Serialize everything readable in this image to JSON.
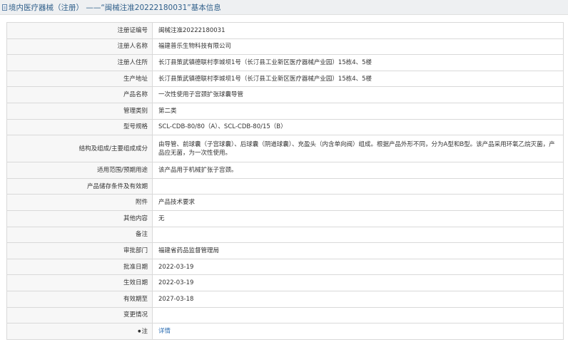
{
  "header": {
    "icon": "document-icon",
    "title": "境内医疗器械（注册） ——“闽械注准20222180031”基本信息"
  },
  "rows": [
    {
      "label": "注册证编号",
      "value": "闽械注准20222180031"
    },
    {
      "label": "注册人名称",
      "value": "福建普乐生物科技有限公司"
    },
    {
      "label": "注册人住所",
      "value": "长汀县策武镇德联村李城坝1号（长汀县工业新区医疗器械产业园）15栋4、5楼"
    },
    {
      "label": "生产地址",
      "value": "长汀县策武镇德联村李城坝1号（长汀县工业新区医疗器械产业园）15栋4、5楼"
    },
    {
      "label": "产品名称",
      "value": "一次性使用子宫颈扩张球囊导管"
    },
    {
      "label": "管理类别",
      "value": "第二类"
    },
    {
      "label": "型号规格",
      "value": "SCL-CDB-80/80（A）、SCL-CDB-80/15（B）"
    },
    {
      "label": "结构及组成/主要组成成分",
      "value": "由导管、前球囊（子宫球囊）、后球囊（阴道球囊）、充盈头（内含单向阀）组成。根据产品外形不同，分为A型和B型。该产品采用环氧乙烷灭菌，产品应无菌，为一次性使用。"
    },
    {
      "label": "适用范围/预期用途",
      "value": "该产品用于机械扩张子宫颈。"
    },
    {
      "label": "产品储存条件及有效期",
      "value": ""
    },
    {
      "label": "附件",
      "value": "产品技术要求"
    },
    {
      "label": "其他内容",
      "value": "无"
    },
    {
      "label": "备注",
      "value": ""
    },
    {
      "label": "审批部门",
      "value": "福建省药品监督管理局"
    },
    {
      "label": "批准日期",
      "value": "2022-03-19"
    },
    {
      "label": "生效日期",
      "value": "2022-03-19"
    },
    {
      "label": "有效期至",
      "value": "2027-03-18"
    },
    {
      "label": "变更情况",
      "value": ""
    },
    {
      "label": "注",
      "value": "详情"
    }
  ]
}
